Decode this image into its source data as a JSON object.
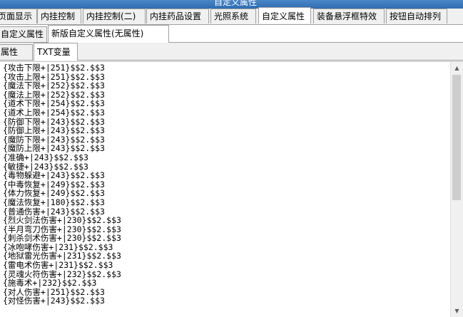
{
  "window": {
    "title": "自定义属性"
  },
  "main_tabs": [
    {
      "label": "页面显示"
    },
    {
      "label": "内挂控制"
    },
    {
      "label": "内挂控制(二)"
    },
    {
      "label": "内挂药品设置"
    },
    {
      "label": "光照系统"
    },
    {
      "label": "自定义属性",
      "active": true
    },
    {
      "label": "装备悬浮框特效"
    },
    {
      "label": "按钮自动排列"
    }
  ],
  "sub_tabs": [
    {
      "label": "自定义属性"
    },
    {
      "label": "新版自定义属性(无属性)",
      "active": true
    }
  ],
  "inner_tabs": [
    {
      "label": "属性"
    },
    {
      "label": "TXT变量",
      "active": true
    }
  ],
  "text_lines": [
    "{攻击下限+|251}$$2.$$3",
    "{攻击上限+|251}$$2.$$3",
    "{魔法下限+|252}$$2.$$3",
    "{魔法上限+|252}$$2.$$3",
    "{道术下限+|254}$$2.$$3",
    "{道术上限+|254}$$2.$$3",
    "{防御下限+|243}$$2.$$3",
    "{防御上限+|243}$$2.$$3",
    "{魔防下限+|243}$$2.$$3",
    "{魔防上限+|243}$$2.$$3",
    "{准确+|243}$$2.$$3",
    "{敏捷+|243}$$2.$$3",
    "{毒物躲避+|243}$$2.$$3",
    "{中毒恢复+|249}$$2.$$3",
    "{体力恢复+|249}$$2.$$3",
    "{魔法恢复+|180}$$2.$$3",
    "{普通伤害+|243}$$2.$$3",
    "{烈火剑法伤害+|230}$$2.$$3",
    "{半月弯刀伤害+|230}$$2.$$3",
    "{刺杀剑术伤害+|230}$$2.$$3",
    "{冰咆哮伤害+|231}$$2.$$3",
    "{地狱雷光伤害+|231}$$2.$$3",
    "{雷电术伤害+|231}$$2.$$3",
    "{灵魂火符伤害+|232}$$2.$$3",
    "{施毒术+|232}$$2.$$3",
    "{对人伤害+|251}$$2.$$3",
    "{对怪伤害+|243}$$2.$$3"
  ],
  "scrollbar": {
    "up_icon": "▲",
    "down_icon": "▼"
  }
}
